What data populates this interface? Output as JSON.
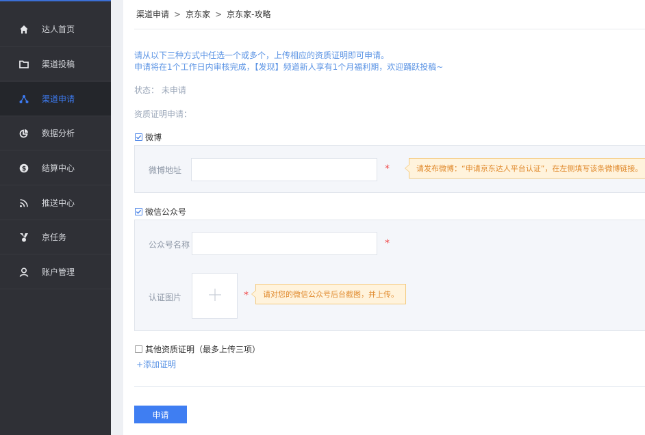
{
  "sidebar": {
    "items": [
      {
        "label": "达人首页",
        "icon": "home-icon"
      },
      {
        "label": "渠道投稿",
        "icon": "folder-icon"
      },
      {
        "label": "渠道申请",
        "icon": "share-nodes-icon",
        "active": true
      },
      {
        "label": "数据分析",
        "icon": "pie-chart-icon"
      },
      {
        "label": "结算中心",
        "icon": "dollar-coin-icon"
      },
      {
        "label": "推送中心",
        "icon": "rss-icon"
      },
      {
        "label": "京任务",
        "icon": "medal-icon"
      },
      {
        "label": "账户管理",
        "icon": "user-icon"
      }
    ]
  },
  "breadcrumb": [
    "渠道申请",
    "京东家",
    "京东家-攻略"
  ],
  "breadcrumb_sep": ">",
  "notice": {
    "line1": "请从以下三种方式中任选一个或多个，上传相应的资质证明即可申请。",
    "line2": "申请将在1个工作日内审核完成，【发现】频道新人享有1个月福利期，欢迎踊跃投稿~"
  },
  "status": "状态： 未申请",
  "qualification_label": "资质证明申请：",
  "weibo": {
    "checkbox_label": "微博",
    "checked": true,
    "field_label": "微博地址",
    "value": "",
    "required_mark": "*",
    "tip": "请发布微博：“申请京东达人平台认证”，在左侧填写该条微博链接。"
  },
  "wechat": {
    "checkbox_label": "微信公众号",
    "checked": true,
    "name_label": "公众号名称",
    "name_value": "",
    "required_mark": "*",
    "image_label": "认证图片",
    "upload_icon": "plus-icon",
    "tip": "请对您的微信公众号后台截图，并上传。"
  },
  "other": {
    "checkbox_label": "其他资质证明（最多上传三项）",
    "checked": false,
    "add_link": "+添加证明"
  },
  "submit_label": "申请",
  "colors": {
    "accent": "#3f7ef2",
    "sidebar_bg": "#2f3036",
    "tip_bg": "#fff3dc",
    "tip_text": "#e08a2d",
    "required": "#f04848"
  }
}
